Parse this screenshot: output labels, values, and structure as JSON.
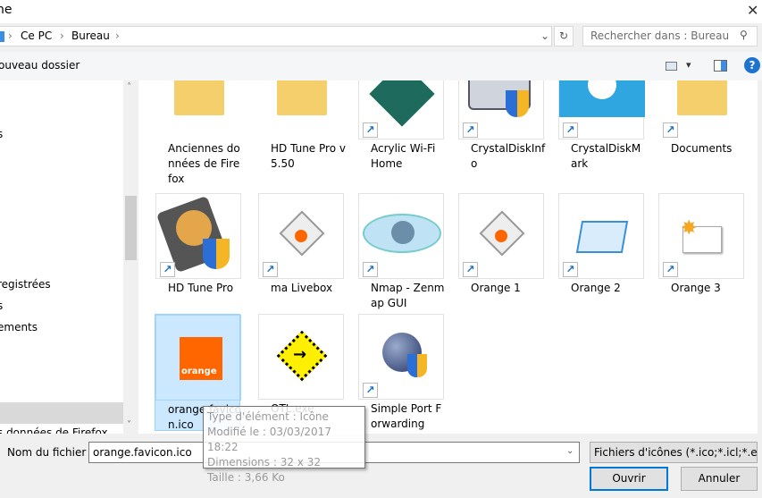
{
  "window": {
    "title_fragment": "ne",
    "close": "✕"
  },
  "address": {
    "crumbs": [
      "Ce PC",
      "Bureau"
    ],
    "separator": "›",
    "dropdown": "⌄",
    "refresh": "↻"
  },
  "search": {
    "placeholder": "Rechercher dans : Bureau",
    "icon": "search-icon"
  },
  "toolbar": {
    "new_folder": "ouveau dossier",
    "view": "▾",
    "help": "?"
  },
  "left_pane": {
    "items": [
      {
        "label": "s"
      },
      {
        "label": "registrées"
      },
      {
        "label": "s"
      },
      {
        "label": "ements"
      },
      {
        "label": ""
      },
      {
        "label": "s données de Firefox"
      }
    ]
  },
  "files": [
    {
      "label": "Anciennes données de Firefox",
      "icon": "folder",
      "shortcut": false
    },
    {
      "label": "HD Tune Pro v5.50",
      "icon": "folder",
      "shortcut": false
    },
    {
      "label": "Acrylic Wi-Fi Home",
      "icon": "acrylic",
      "shortcut": true
    },
    {
      "label": "CrystalDiskInfo",
      "icon": "disk",
      "shortcut": true
    },
    {
      "label": "CrystalDiskMark",
      "icon": "flower",
      "shortcut": true
    },
    {
      "label": "Documents",
      "icon": "folder",
      "shortcut": true
    },
    {
      "label": "HD Tune Pro",
      "icon": "harddisk",
      "shortcut": true
    },
    {
      "label": "ma Livebox",
      "icon": "livebox",
      "shortcut": true
    },
    {
      "label": "Nmap - Zenmap GUI",
      "icon": "eye",
      "shortcut": true
    },
    {
      "label": "Orange 1",
      "icon": "livebox",
      "shortcut": true
    },
    {
      "label": "Orange 2",
      "icon": "window",
      "shortcut": true
    },
    {
      "label": "Orange 3",
      "icon": "mail",
      "shortcut": true
    },
    {
      "label": "orange.favicon.ico",
      "icon": "orange",
      "shortcut": false,
      "selected": true
    },
    {
      "label": "OTL.exe",
      "icon": "otl",
      "shortcut": false
    },
    {
      "label": "Simple Port Forwarding",
      "icon": "globe",
      "shortcut": true
    }
  ],
  "orange_logo_text": "orange",
  "filename": {
    "label": "Nom du fichier :",
    "value": "orange.favicon.ico"
  },
  "filter": {
    "value": "Fichiers d'icônes (*.ico;*.icl;*.exe"
  },
  "buttons": {
    "open": "Ouvrir",
    "cancel": "Annuler"
  },
  "tooltip": {
    "type": "Type d'élément : Icône",
    "modified": "Modifié le : 03/03/2017 18:22",
    "dimensions": "Dimensions : 32 x 32",
    "size": "Taille : 3,66 Ko"
  },
  "colors": {
    "accent": "#0078d7",
    "selection": "#cce8ff",
    "orange": "#ff6600"
  }
}
